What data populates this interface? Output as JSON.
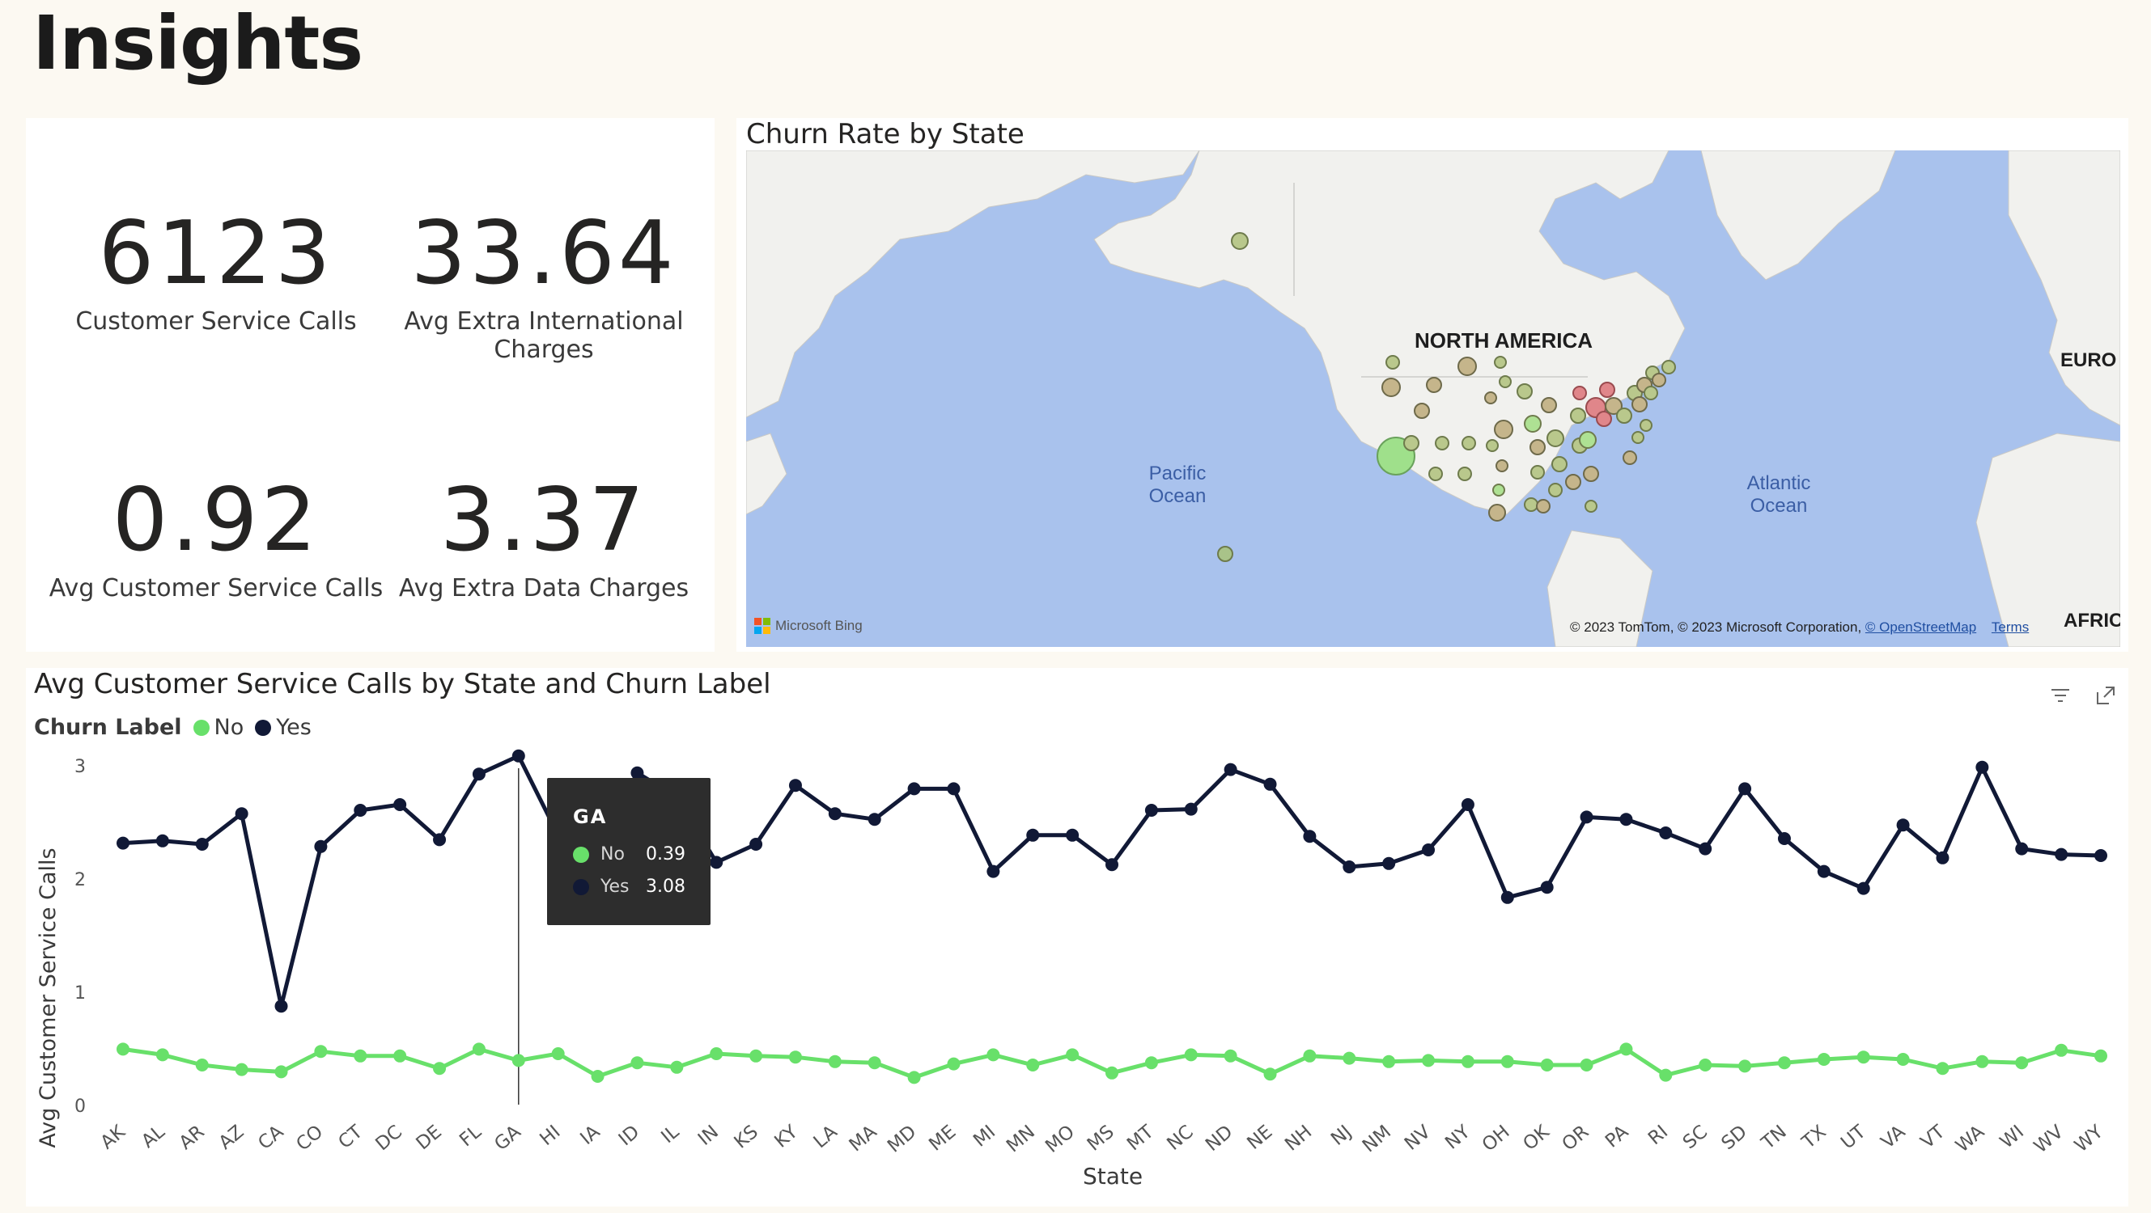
{
  "page": {
    "title": "Insights"
  },
  "kpis": [
    {
      "value": "6123",
      "label": "Customer Service Calls"
    },
    {
      "value": "33.64",
      "label": "Avg Extra International Charges"
    },
    {
      "value": "0.92",
      "label": "Avg Customer Service Calls"
    },
    {
      "value": "3.37",
      "label": "Avg Extra Data Charges"
    }
  ],
  "map": {
    "title": "Churn Rate by State",
    "labels": {
      "north_america": "NORTH AMERICA",
      "pacific_line1": "Pacific",
      "pacific_line2": "Ocean",
      "atlantic_line1": "Atlantic",
      "atlantic_line2": "Ocean",
      "europe": "EURO",
      "africa": "AFRIC"
    },
    "bing_logo": "Microsoft Bing",
    "attribution": "© 2023 TomTom, © 2023 Microsoft Corporation,",
    "attribution_link": "© OpenStreetMap",
    "terms": "Terms",
    "colors": {
      "water": "#a9c2ed",
      "land": "#f2f2f0",
      "bubble_low": "#8ed67a",
      "bubble_mid": "#b5ae7a",
      "bubble_high": "#e0868a"
    }
  },
  "chart": {
    "title": "Avg Customer Service Calls by State and Churn Label",
    "legend_title": "Churn Label",
    "tooltip": {
      "state": "GA",
      "no_label": "No",
      "no_value": "0.39",
      "yes_label": "Yes",
      "yes_value": "3.08"
    },
    "icons": {
      "filter": "filter-icon",
      "focus": "focus-mode-icon"
    }
  },
  "chart_data": {
    "type": "line",
    "title": "Avg Customer Service Calls by State and Churn Label",
    "xlabel": "State",
    "ylabel": "Avg Customer Service Calls",
    "ylim": [
      0,
      3.3
    ],
    "yticks": [
      0,
      1,
      2,
      3
    ],
    "grid": false,
    "legend_position": "top-left",
    "categories": [
      "AK",
      "AL",
      "AR",
      "AZ",
      "CA",
      "CO",
      "CT",
      "DC",
      "DE",
      "FL",
      "GA",
      "HI",
      "IA",
      "ID",
      "IL",
      "IN",
      "KS",
      "KY",
      "LA",
      "MA",
      "MD",
      "ME",
      "MI",
      "MN",
      "MO",
      "MS",
      "MT",
      "NC",
      "ND",
      "NE",
      "NH",
      "NJ",
      "NM",
      "NV",
      "NY",
      "OH",
      "OK",
      "OR",
      "PA",
      "RI",
      "SC",
      "SD",
      "TN",
      "TX",
      "UT",
      "VA",
      "VT",
      "WA",
      "WI",
      "WV",
      "WY"
    ],
    "series": [
      {
        "name": "No",
        "color": "#68e06a",
        "values": [
          0.49,
          0.44,
          0.35,
          0.31,
          0.29,
          0.47,
          0.43,
          0.43,
          0.32,
          0.49,
          0.39,
          0.45,
          0.25,
          0.37,
          0.33,
          0.45,
          0.43,
          0.42,
          0.38,
          0.37,
          0.24,
          0.36,
          0.44,
          0.35,
          0.44,
          0.28,
          0.37,
          0.44,
          0.43,
          0.27,
          0.43,
          0.41,
          0.38,
          0.39,
          0.38,
          0.38,
          0.35,
          0.35,
          0.49,
          0.26,
          0.35,
          0.34,
          0.37,
          0.4,
          0.42,
          0.4,
          0.32,
          0.38,
          0.37,
          0.48,
          0.43
        ]
      },
      {
        "name": "Yes",
        "color": "#111936",
        "values": [
          2.31,
          2.33,
          2.3,
          2.57,
          0.87,
          2.28,
          2.6,
          2.65,
          2.34,
          2.92,
          3.08,
          2.38,
          2.24,
          2.93,
          2.72,
          2.14,
          2.3,
          2.82,
          2.57,
          2.52,
          2.79,
          2.79,
          2.06,
          2.38,
          2.38,
          2.12,
          2.6,
          2.61,
          2.96,
          2.83,
          2.37,
          2.1,
          2.13,
          2.25,
          2.65,
          1.83,
          1.92,
          2.54,
          2.52,
          2.4,
          2.26,
          2.79,
          2.35,
          2.06,
          1.91,
          2.47,
          2.18,
          2.98,
          2.26,
          2.21,
          2.2
        ]
      }
    ]
  }
}
